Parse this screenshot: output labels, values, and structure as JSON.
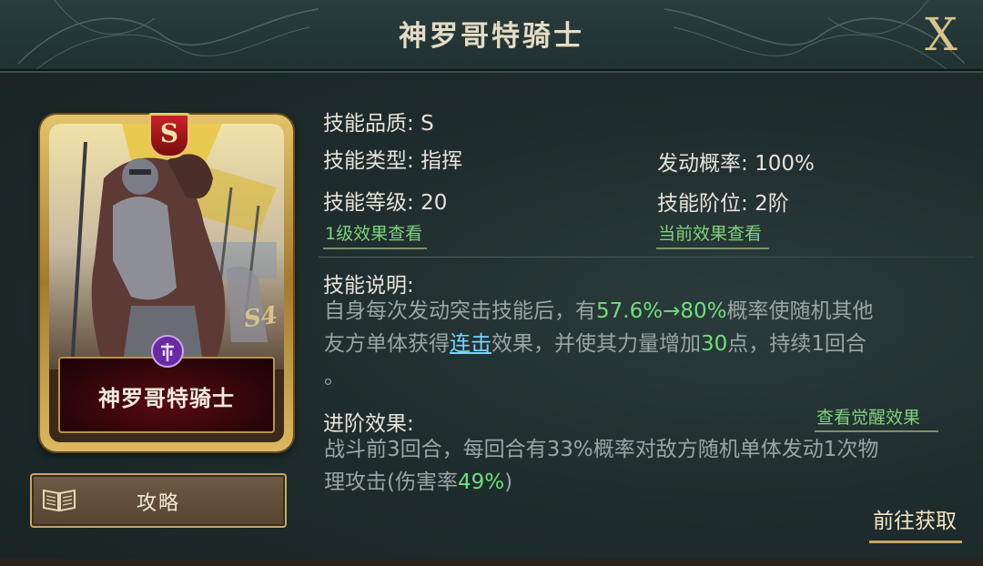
{
  "header": {
    "title": "神罗哥特骑士",
    "close_label": "X"
  },
  "card": {
    "name": "神罗哥特骑士",
    "grade": "S",
    "season_mark": "S4"
  },
  "guide_button": {
    "label": "攻略"
  },
  "stats": {
    "quality_label": "技能品质:",
    "quality_value": "S",
    "type_label": "技能类型:",
    "type_value": "指挥",
    "level_label": "技能等级:",
    "level_value": "20",
    "trigger_label": "发动概率:",
    "trigger_value": "100%",
    "tier_label": "技能阶位:",
    "tier_value": "2阶"
  },
  "links": {
    "level1_effect": "1级效果查看",
    "current_effect": "当前效果查看",
    "awaken_effect": "查看觉醒效果"
  },
  "description": {
    "heading": "技能说明:",
    "line1_a": "自身每次发动突击技能后，有",
    "line1_hl": "57.6%→80%",
    "line1_b": "概率使随机其他",
    "line2_a": "友方单体获得",
    "line2_kw": "连击",
    "line2_b": "效果，并使其力量增加",
    "line2_hl": "30",
    "line2_c": "点，持续1回合",
    "line3": "。"
  },
  "advance": {
    "heading": "进阶效果:",
    "line1": "战斗前3回合，每回合有33%概率对敌方随机单体发动1次物",
    "line2_a": "理攻击(伤害率",
    "line2_hl": "49%",
    "line2_b": ")"
  },
  "goto_button": {
    "label": "前往获取"
  },
  "colors": {
    "highlight_green": "#6fe07b",
    "keyword_cyan": "#75d5ff",
    "link_green": "#7fd37a",
    "gold": "#c9a65e"
  }
}
